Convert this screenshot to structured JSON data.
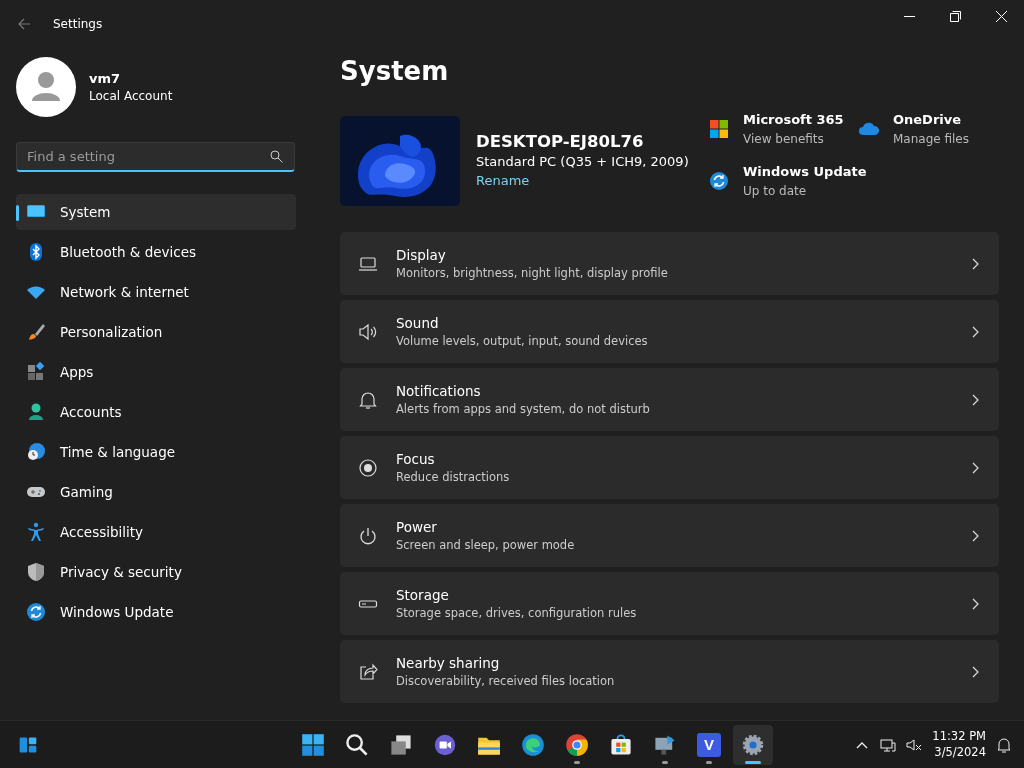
{
  "window": {
    "title": "Settings"
  },
  "account": {
    "name": "vm7",
    "type": "Local Account"
  },
  "search": {
    "placeholder": "Find a setting"
  },
  "nav": [
    {
      "label": "System",
      "kind": "system",
      "selected": true
    },
    {
      "label": "Bluetooth & devices",
      "kind": "bluetooth",
      "selected": false
    },
    {
      "label": "Network & internet",
      "kind": "wifi",
      "selected": false
    },
    {
      "label": "Personalization",
      "kind": "brush",
      "selected": false
    },
    {
      "label": "Apps",
      "kind": "apps",
      "selected": false
    },
    {
      "label": "Accounts",
      "kind": "person",
      "selected": false
    },
    {
      "label": "Time & language",
      "kind": "clock",
      "selected": false
    },
    {
      "label": "Gaming",
      "kind": "gamepad",
      "selected": false
    },
    {
      "label": "Accessibility",
      "kind": "accessibility",
      "selected": false
    },
    {
      "label": "Privacy & security",
      "kind": "shield",
      "selected": false
    },
    {
      "label": "Windows Update",
      "kind": "update",
      "selected": false
    }
  ],
  "page": {
    "title": "System"
  },
  "device": {
    "name": "DESKTOP-EJ80L76",
    "model": "Standard PC (Q35 + ICH9, 2009)",
    "rename": "Rename"
  },
  "quick_links": [
    {
      "kind": "tiles",
      "title": "Microsoft 365",
      "subtitle": "View benefits"
    },
    {
      "kind": "cloud",
      "title": "OneDrive",
      "subtitle": "Manage files"
    },
    {
      "kind": "update",
      "title": "Windows Update",
      "subtitle": "Up to date"
    }
  ],
  "settings": [
    {
      "kind": "display",
      "title": "Display",
      "subtitle": "Monitors, brightness, night light, display profile"
    },
    {
      "kind": "sound",
      "title": "Sound",
      "subtitle": "Volume levels, output, input, sound devices"
    },
    {
      "kind": "bell",
      "title": "Notifications",
      "subtitle": "Alerts from apps and system, do not disturb"
    },
    {
      "kind": "focus",
      "title": "Focus",
      "subtitle": "Reduce distractions"
    },
    {
      "kind": "power",
      "title": "Power",
      "subtitle": "Screen and sleep, power mode"
    },
    {
      "kind": "storage",
      "title": "Storage",
      "subtitle": "Storage space, drives, configuration rules"
    },
    {
      "kind": "share",
      "title": "Nearby sharing",
      "subtitle": "Discoverability, received files location"
    }
  ],
  "taskbar": {
    "apps": [
      {
        "kind": "start",
        "running": false,
        "selected": false
      },
      {
        "kind": "search",
        "running": false,
        "selected": false
      },
      {
        "kind": "taskview",
        "running": false,
        "selected": false
      },
      {
        "kind": "chat",
        "running": false,
        "selected": false
      },
      {
        "kind": "folder",
        "running": false,
        "selected": false
      },
      {
        "kind": "edge",
        "running": false,
        "selected": false
      },
      {
        "kind": "chrome",
        "running": true,
        "selected": false
      },
      {
        "kind": "store",
        "running": false,
        "selected": false
      },
      {
        "kind": "monitor",
        "running": true,
        "selected": false
      },
      {
        "kind": "letter",
        "label": "V",
        "running": true,
        "selected": false
      },
      {
        "kind": "gear",
        "running": true,
        "selected": true
      }
    ],
    "time": "11:32 PM",
    "date": "3/5/2024"
  }
}
